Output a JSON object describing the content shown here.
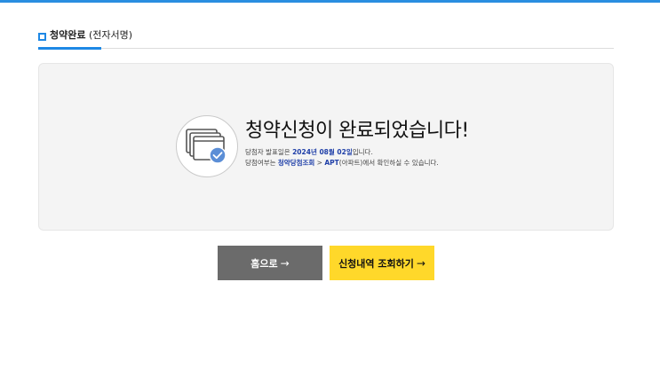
{
  "section": {
    "title": "청약완료",
    "title_sub": "(전자서명)"
  },
  "result": {
    "headline": "청약신청이 완료되었습니다!",
    "line1_prefix": "당첨자 발표일은 ",
    "announce_date": "2024년 08월 02일",
    "line1_suffix": "입니다.",
    "line2_prefix": "당첨여부는 ",
    "menu_path_1": "청약당첨조회",
    "menu_sep": " > ",
    "menu_path_2": "APT",
    "menu_path_2_sub": "(아파트)",
    "line2_suffix": "에서 확인하실 수 있습니다."
  },
  "buttons": {
    "home_label": "홈으로",
    "check_label": "신청내역 조회하기",
    "arrow": "→"
  },
  "colors": {
    "accent_blue": "#1e88e5",
    "button_gray": "#6b6b6b",
    "button_yellow": "#ffd82a",
    "highlight_text": "#1f3fa8"
  },
  "icons": {
    "section_marker": "square-marker-icon",
    "completion": "document-check-icon"
  }
}
